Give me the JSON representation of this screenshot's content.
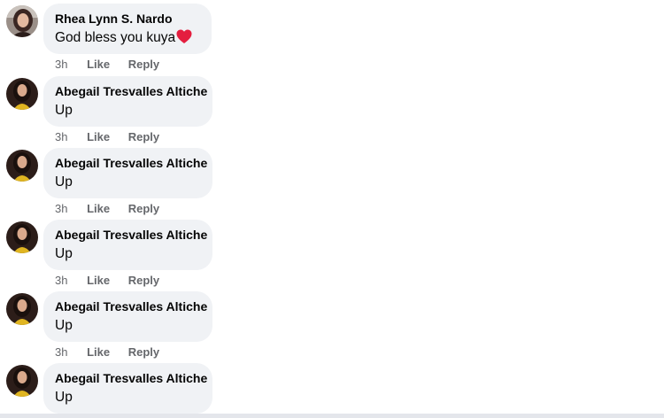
{
  "comments": [
    {
      "author": "Rhea Lynn S. Nardo",
      "text": "God bless you kuya",
      "emoji": "heart-icon",
      "time": "3h",
      "like": "Like",
      "reply": "Reply",
      "avatar": "avatar-photo-rhea"
    },
    {
      "author": "Abegail Tresvalles Altiche",
      "text": "Up",
      "time": "3h",
      "like": "Like",
      "reply": "Reply",
      "avatar": "avatar-photo-abegail"
    },
    {
      "author": "Abegail Tresvalles Altiche",
      "text": "Up",
      "time": "3h",
      "like": "Like",
      "reply": "Reply",
      "avatar": "avatar-photo-abegail"
    },
    {
      "author": "Abegail Tresvalles Altiche",
      "text": "Up",
      "time": "3h",
      "like": "Like",
      "reply": "Reply",
      "avatar": "avatar-photo-abegail"
    },
    {
      "author": "Abegail Tresvalles Altiche",
      "text": "Up",
      "time": "3h",
      "like": "Like",
      "reply": "Reply",
      "avatar": "avatar-photo-abegail"
    },
    {
      "author": "Abegail Tresvalles Altiche",
      "text": "Up"
    }
  ],
  "colors": {
    "bubble_bg": "#f0f2f5",
    "text": "#050505",
    "meta_text": "#65676b",
    "heart": "#e41e3f"
  }
}
